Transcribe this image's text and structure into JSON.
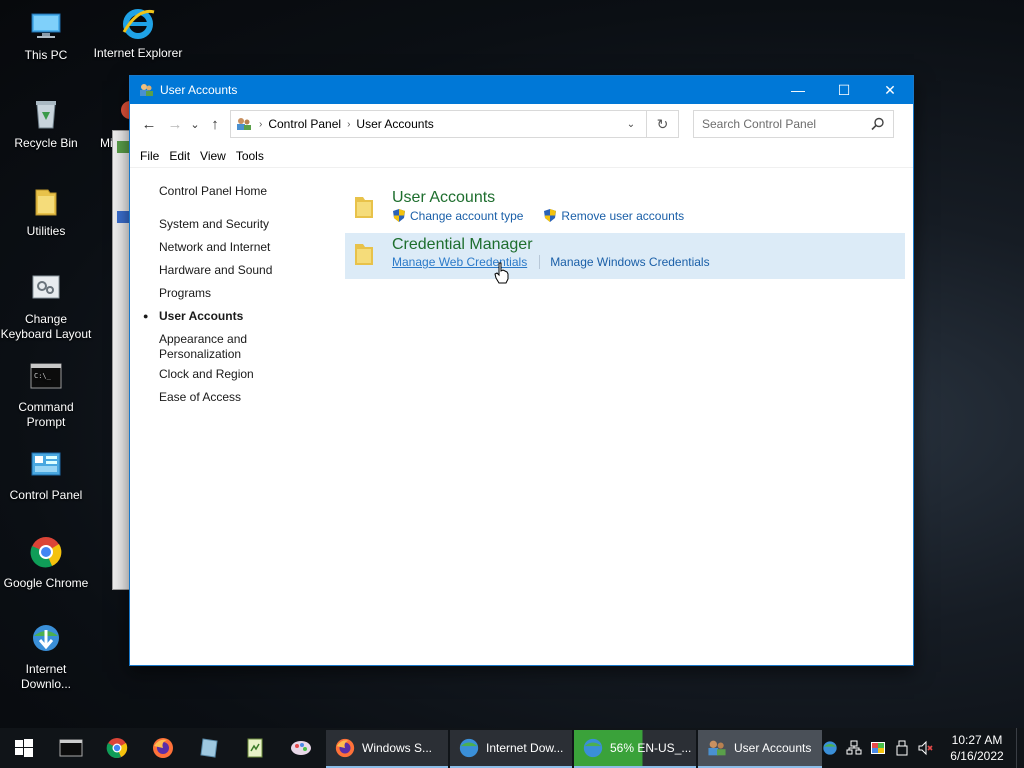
{
  "desktop": {
    "icons": [
      {
        "label": "This PC"
      },
      {
        "label": "Internet Explorer"
      },
      {
        "label": "Recycle Bin"
      },
      {
        "label": "Mi"
      },
      {
        "label": "Utilities"
      },
      {
        "label": "Change Keyboard Layout"
      },
      {
        "label": "Command Prompt"
      },
      {
        "label": "Control Panel"
      },
      {
        "label": "Google Chrome"
      },
      {
        "label": "Internet Downlo..."
      }
    ]
  },
  "window": {
    "title": "User Accounts",
    "controls": {
      "minimize": "—",
      "maximize": "☐",
      "close": "✕"
    }
  },
  "address": {
    "back": "←",
    "forward": "→",
    "recent": "⌄",
    "up": "↑",
    "crumbs": [
      "Control Panel",
      "User Accounts"
    ],
    "separator": "›",
    "dropdown": "⌄",
    "refresh": "↻",
    "search_placeholder": "Search Control Panel"
  },
  "menu": [
    "File",
    "Edit",
    "View",
    "Tools"
  ],
  "leftnav": {
    "home": "Control Panel Home",
    "items": [
      "System and Security",
      "Network and Internet",
      "Hardware and Sound",
      "Programs",
      "User Accounts",
      "Appearance and Personalization",
      "Clock and Region",
      "Ease of Access"
    ],
    "active_index": 4
  },
  "categories": [
    {
      "title": "User Accounts",
      "links": [
        "Change account type",
        "Remove user accounts"
      ]
    },
    {
      "title": "Credential Manager",
      "links": [
        "Manage Web Credentials",
        "Manage Windows Credentials"
      ]
    }
  ],
  "taskbar": {
    "tasks": [
      {
        "label": "Windows S..."
      },
      {
        "label": "Internet Dow..."
      },
      {
        "label": "56% EN-US_..."
      },
      {
        "label": "User Accounts"
      }
    ],
    "progress_percent": 56,
    "time": "10:27 AM",
    "date": "6/16/2022"
  },
  "colors": {
    "titlebar": "#0078d7",
    "category_title": "#1e6e2e",
    "link": "#1a5fa8",
    "highlight": "#dcebf7",
    "taskbar": "#101418"
  }
}
